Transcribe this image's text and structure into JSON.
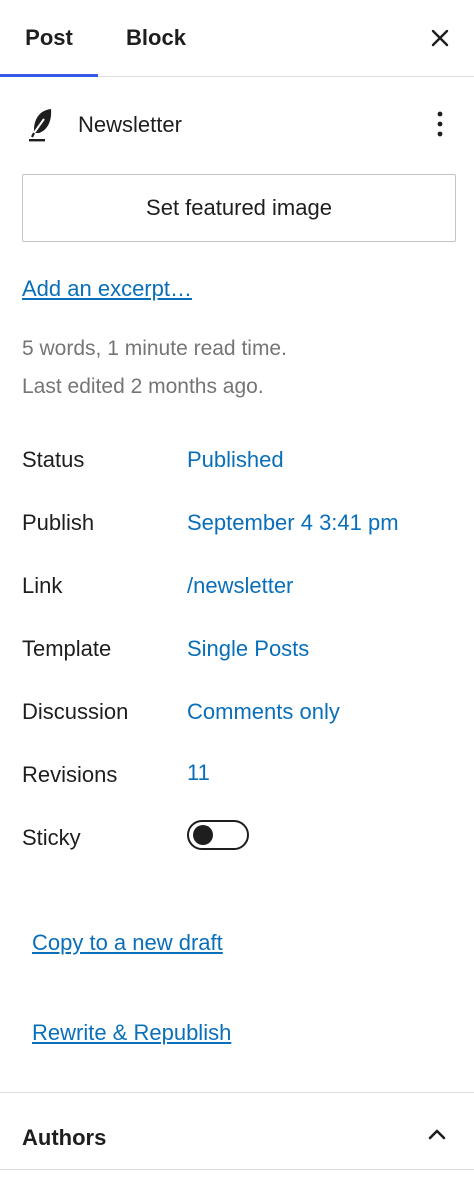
{
  "tabs": {
    "post": "Post",
    "block": "Block",
    "close_icon": "close-icon"
  },
  "post": {
    "title": "Newsletter",
    "icon": "feather-icon",
    "more_icon": "more-vertical-icon"
  },
  "featured_image": {
    "label": "Set featured image"
  },
  "excerpt": {
    "label": "Add an excerpt…"
  },
  "meta": {
    "words": "5 words, 1 minute read time.",
    "edited": "Last edited 2 months ago."
  },
  "settings": {
    "status": {
      "label": "Status",
      "value": "Published"
    },
    "publish": {
      "label": "Publish",
      "value": "September 4 3:41 pm"
    },
    "link": {
      "label": "Link",
      "value": "/newsletter"
    },
    "template": {
      "label": "Template",
      "value": "Single Posts"
    },
    "discussion": {
      "label": "Discussion",
      "value": "Comments only"
    },
    "revisions": {
      "label": "Revisions",
      "value": "11"
    },
    "sticky": {
      "label": "Sticky",
      "checked": false
    }
  },
  "actions": {
    "copy": "Copy to a new draft",
    "rewrite": "Rewrite & Republish"
  },
  "authors": {
    "title": "Authors",
    "icon": "chevron-up-icon"
  },
  "colors": {
    "accent": "#3858e9",
    "link": "#0a6fba",
    "text": "#1e1e1e",
    "muted": "#757575"
  }
}
